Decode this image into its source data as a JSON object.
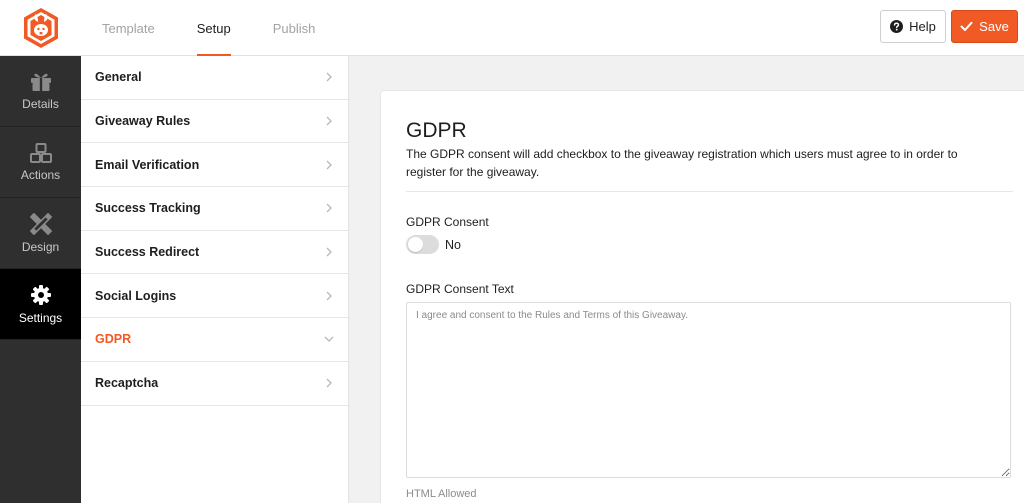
{
  "header": {
    "tabs": [
      {
        "label": "Template"
      },
      {
        "label": "Setup"
      },
      {
        "label": "Publish"
      }
    ],
    "active_tab": "Setup",
    "help_label": "Help",
    "save_label": "Save",
    "accent_color": "#f15a24"
  },
  "rail": {
    "items": [
      {
        "label": "Details",
        "icon": "gift-icon"
      },
      {
        "label": "Actions",
        "icon": "boxes-icon"
      },
      {
        "label": "Design",
        "icon": "pencil-ruler-icon"
      },
      {
        "label": "Settings",
        "icon": "gear-icon"
      }
    ],
    "active": "Settings"
  },
  "settings_list": {
    "items": [
      {
        "label": "General"
      },
      {
        "label": "Giveaway Rules"
      },
      {
        "label": "Email Verification"
      },
      {
        "label": "Success Tracking"
      },
      {
        "label": "Success Redirect"
      },
      {
        "label": "Social Logins"
      },
      {
        "label": "GDPR"
      },
      {
        "label": "Recaptcha"
      }
    ],
    "active": "GDPR"
  },
  "main": {
    "title": "GDPR",
    "description": "The GDPR consent will add checkbox to the giveaway registration which users must agree to in order to register for the giveaway.",
    "consent_label": "GDPR Consent",
    "consent_toggle_value": "No",
    "consent_text_label": "GDPR Consent Text",
    "consent_text_value": "",
    "consent_text_placeholder": "I agree and consent to the Rules and Terms of this Giveaway.",
    "hint": "HTML Allowed"
  }
}
